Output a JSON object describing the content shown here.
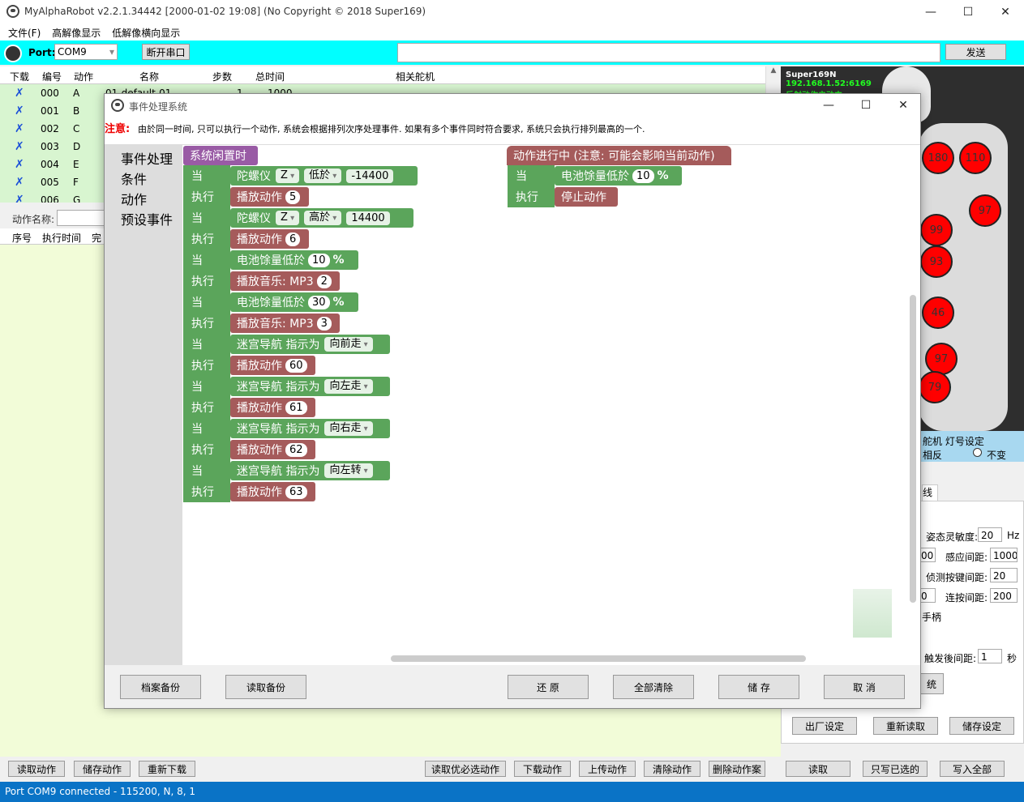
{
  "window": {
    "title": "MyAlphaRobot v2.2.1.34442  [2000-01-02 19:08]  (No Copyright © 2018 Super169)"
  },
  "menu": [
    "文件(F)",
    "高解像显示",
    "低解像横向显示"
  ],
  "toolbar": {
    "port_label": "Port:",
    "port_value": "COM9",
    "disconnect": "断开串口",
    "send": "发送"
  },
  "table": {
    "headers": [
      "下载",
      "编号",
      "动作",
      "名称",
      "步数",
      "总时间",
      "相关舵机"
    ],
    "rows": [
      {
        "mark": "✗",
        "id": "000",
        "act": "A",
        "name": "01-default-01",
        "steps": "1",
        "time": "1000"
      },
      {
        "mark": "✗",
        "id": "001",
        "act": "B"
      },
      {
        "mark": "✗",
        "id": "002",
        "act": "C"
      },
      {
        "mark": "✗",
        "id": "003",
        "act": "D"
      },
      {
        "mark": "✗",
        "id": "004",
        "act": "E"
      },
      {
        "mark": "✗",
        "id": "005",
        "act": "F"
      },
      {
        "mark": "✗",
        "id": "006",
        "act": "G"
      }
    ]
  },
  "action_name_label": "动作名称:",
  "steps_headers": [
    "序号",
    "执行时间",
    "完"
  ],
  "bottom_buttons": [
    "读取动作",
    "储存动作",
    "重新下载",
    "读取优必选动作",
    "下载动作",
    "上传动作",
    "清除动作",
    "删除动作案",
    "读取",
    "只写已选的",
    "写入全部"
  ],
  "status": "Port COM9 connected - 115200, N, 8, 1",
  "robot": {
    "name": "Super169N",
    "ip": "192.168.1.52:6169",
    "state": "反射动作启动中",
    "servos": [
      "180",
      "110",
      "97",
      "99",
      "93",
      "46",
      "97",
      "79"
    ]
  },
  "right": {
    "servo_light": "舵机 灯号设定",
    "invert": "相反",
    "unchanged": "不变",
    "tab": "线",
    "sensitivity_label": "姿态灵敏度:",
    "sensitivity": "20",
    "hz": "Hz",
    "v_left1": "00",
    "interval_label": "感应间距:",
    "interval": "1000",
    "key_label": "侦测按键间距:",
    "key": "20",
    "v_left2": "0",
    "repeat_label": "连按间距:",
    "repeat": "200",
    "handle": "手柄",
    "trigger_label": "触发後间距:",
    "trigger": "1",
    "sec": "秒",
    "sys_btn": "统",
    "factory": "出厂设定",
    "reread": "重新读取",
    "save": "储存设定"
  },
  "dialog": {
    "title": "事件处理系统",
    "notice_label": "注意:",
    "notice_text": "由於同一时间, 只可以执行一个动作, 系统会根据排列次序处理事件. 如果有多个事件同时符合要求, 系统只会执行排列最高的一个.",
    "categories": [
      "事件处理",
      "条件",
      "动作",
      "预设事件"
    ],
    "idle_header": "系统闲置时",
    "running_header": "动作进行中 (注意: 可能会影响当前动作)",
    "when": "当",
    "exec": "执行",
    "blocks": [
      {
        "cond": "陀螺仪",
        "f1": "Z",
        "f2": "低於",
        "v": "-14400",
        "act": "播放动作",
        "n": "5"
      },
      {
        "cond": "陀螺仪",
        "f1": "Z",
        "f2": "高於",
        "v": "14400",
        "act": "播放动作",
        "n": "6"
      },
      {
        "cond": "电池馀量低於",
        "v": "10",
        "unit": "%",
        "act": "播放音乐: MP3",
        "n": "2"
      },
      {
        "cond": "电池馀量低於",
        "v": "30",
        "unit": "%",
        "act": "播放音乐: MP3",
        "n": "3"
      },
      {
        "cond": "迷宫导航 指示为",
        "f1": "向前走",
        "act": "播放动作",
        "n": "60"
      },
      {
        "cond": "迷宫导航 指示为",
        "f1": "向左走",
        "act": "播放动作",
        "n": "61"
      },
      {
        "cond": "迷宫导航 指示为",
        "f1": "向右走",
        "act": "播放动作",
        "n": "62"
      },
      {
        "cond": "迷宫导航 指示为",
        "f1": "向左转",
        "act": "播放动作",
        "n": "63"
      }
    ],
    "running_block": {
      "cond": "电池馀量低於",
      "v": "10",
      "unit": "%",
      "act": "停止动作"
    },
    "buttons": [
      "档案备份",
      "读取备份",
      "还 原",
      "全部清除",
      "储 存",
      "取 消"
    ]
  }
}
